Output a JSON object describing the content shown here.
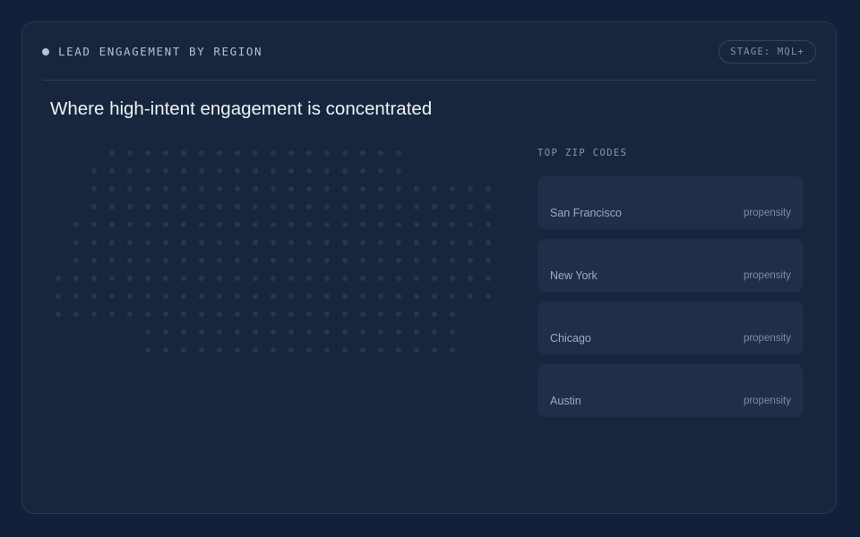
{
  "header": {
    "title": "LEAD ENGAGEMENT BY REGION",
    "stage_badge": "STAGE: MQL+"
  },
  "main": {
    "title": "Where high-intent engagement is concentrated"
  },
  "zip_codes": {
    "title": "TOP ZIP CODES",
    "items": [
      {
        "city": "San Francisco",
        "metric_label": "propensity"
      },
      {
        "city": "New York",
        "metric_label": "propensity"
      },
      {
        "city": "Chicago",
        "metric_label": "propensity"
      },
      {
        "city": "Austin",
        "metric_label": "propensity"
      }
    ]
  },
  "colors": {
    "background": "#132039",
    "panel": "#18263d",
    "card": "#1f2f49",
    "map_dot": "#263650"
  }
}
